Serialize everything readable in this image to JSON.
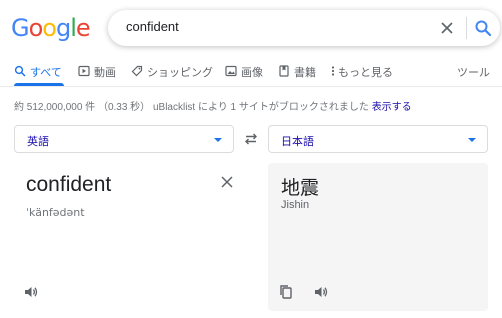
{
  "logo": {
    "letters": [
      {
        "char": "G",
        "color": "#4285F4"
      },
      {
        "char": "o",
        "color": "#EA4335"
      },
      {
        "char": "o",
        "color": "#FBBC05"
      },
      {
        "char": "g",
        "color": "#4285F4"
      },
      {
        "char": "l",
        "color": "#34A853"
      },
      {
        "char": "e",
        "color": "#EA4335"
      }
    ]
  },
  "search": {
    "query": "confident",
    "clear_icon": "close-icon",
    "search_icon": "search-icon"
  },
  "tabs": [
    {
      "label": "すべて",
      "icon": "search-icon",
      "active": true
    },
    {
      "label": "動画",
      "icon": "video-icon",
      "active": false
    },
    {
      "label": "ショッピング",
      "icon": "tag-icon",
      "active": false
    },
    {
      "label": "画像",
      "icon": "image-icon",
      "active": false
    },
    {
      "label": "書籍",
      "icon": "book-icon",
      "active": false
    },
    {
      "label": "もっと見る",
      "icon": "more-vert-icon",
      "active": false
    }
  ],
  "tools_label": "ツール",
  "stats": {
    "text": "約 512,000,000 件 （0.33 秒） uBlacklist により 1 サイトがブロックされました",
    "link": "表示する"
  },
  "translate": {
    "source_lang": "英語",
    "target_lang": "日本語",
    "source_text": "confident",
    "source_pron": "ˈkänfədənt",
    "target_text": "地震",
    "target_roman": "Jishin"
  },
  "colors": {
    "accent": "#1a73e8",
    "link": "#1a0dab",
    "panel_bg": "#f5f5f5"
  }
}
